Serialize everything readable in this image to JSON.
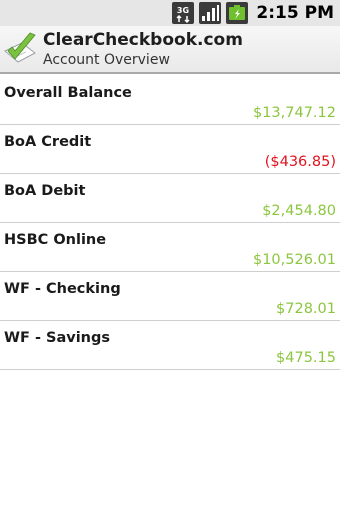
{
  "status_bar": {
    "network_label": "3G",
    "network_icon": "3g-data-icon",
    "signal_icon": "signal-bars-icon",
    "battery_icon": "battery-charging-icon",
    "time": "2:15 PM"
  },
  "header": {
    "app_icon": "checkbook-check-icon",
    "title": "ClearCheckbook.com",
    "subtitle": "Account Overview"
  },
  "colors": {
    "positive": "#8cc63f",
    "negative": "#e0141e"
  },
  "accounts": [
    {
      "name": "Overall Balance",
      "balance": "$13,747.12",
      "status": "positive"
    },
    {
      "name": "BoA Credit",
      "balance": "($436.85)",
      "status": "negative"
    },
    {
      "name": "BoA Debit",
      "balance": "$2,454.80",
      "status": "positive"
    },
    {
      "name": "HSBC Online",
      "balance": "$10,526.01",
      "status": "positive"
    },
    {
      "name": "WF - Checking",
      "balance": "$728.01",
      "status": "positive"
    },
    {
      "name": "WF - Savings",
      "balance": "$475.15",
      "status": "positive"
    }
  ]
}
